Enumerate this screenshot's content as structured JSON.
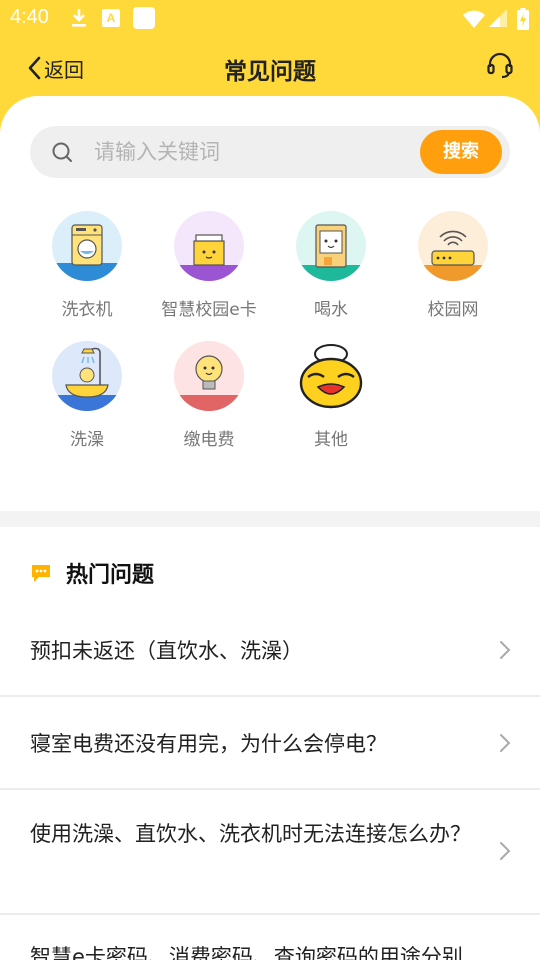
{
  "status_bar": {
    "time": "4:40",
    "icons": [
      "download-icon",
      "app-a-icon",
      "square-app-icon",
      "wifi-icon",
      "signal-icon",
      "battery-icon"
    ],
    "a_glyph": "A"
  },
  "header": {
    "back_label": "返回",
    "title": "常见问题",
    "support_icon": "headset-icon"
  },
  "search": {
    "placeholder": "请输入关键词",
    "value": "",
    "button_label": "搜索"
  },
  "categories": [
    {
      "label": "洗衣机",
      "icon": "washing-machine-icon"
    },
    {
      "label": "智慧校园e卡",
      "icon": "campus-card-icon"
    },
    {
      "label": "喝水",
      "icon": "water-dispenser-icon"
    },
    {
      "label": "校园网",
      "icon": "router-icon"
    },
    {
      "label": "洗澡",
      "icon": "shower-icon"
    },
    {
      "label": "缴电费",
      "icon": "light-bulb-icon"
    },
    {
      "label": "其他",
      "icon": "other-mascot-icon"
    }
  ],
  "hot": {
    "title": "热门问题",
    "icon": "chat-bubble-icon"
  },
  "faqs": [
    {
      "text": "预扣未返还（直饮水、洗澡）"
    },
    {
      "text": "寝室电费还没有用完，为什么会停电？"
    },
    {
      "text": "使用洗澡、直饮水、洗衣机时无法连接怎么办？"
    },
    {
      "text": "智慧e卡密码、消费密码、查询密码的用途分别"
    }
  ],
  "colors": {
    "brand_yellow": "#ffd93a",
    "accent_orange": "#ff9f0e",
    "sheet_bg": "#ffffff"
  }
}
